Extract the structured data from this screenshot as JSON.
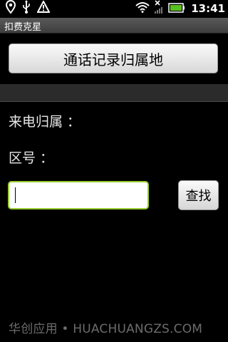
{
  "status_bar": {
    "time": "13:41",
    "icons": [
      "location-pin-icon",
      "usb-icon",
      "warning-icon",
      "wifi-icon",
      "signal-off-icon",
      "battery-icon"
    ]
  },
  "app": {
    "title": "扣费克星"
  },
  "main": {
    "call_log_button_label": "通话记录归属地",
    "caller_attribution_label": "来电归属 ：",
    "area_code_label": "区号 ：",
    "area_code_input": {
      "value": "",
      "placeholder": ""
    },
    "search_button_label": "查找"
  },
  "watermark": "华创应用 • HUACHUANGZS.COM",
  "colors": {
    "input_focus_border": "#9acd32",
    "battery_fill": "#58c020",
    "background": "#000000"
  }
}
